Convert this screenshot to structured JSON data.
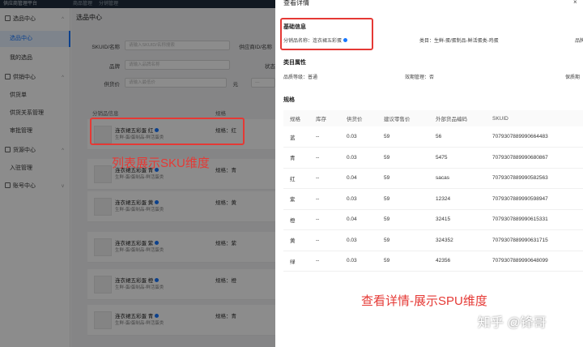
{
  "topbar": {
    "brand": "供应商管理平台",
    "tabs": [
      "商品管理",
      "分销管理"
    ]
  },
  "sidebar": {
    "groups": [
      {
        "label": "选品中心",
        "items": [
          "选品中心",
          "我的选品"
        ]
      },
      {
        "label": "供销中心",
        "items": [
          "供货单",
          "供货关系管理",
          "审批管理"
        ]
      },
      {
        "label": "货源中心",
        "items": [
          "入驻管理"
        ]
      },
      {
        "label": "账号中心",
        "items": []
      }
    ],
    "active_item": "选品中心"
  },
  "main": {
    "title": "选品中心",
    "filters": {
      "sku_label": "SKUID/名称",
      "sku_placeholder": "请输入SKUID/名称搜索",
      "supplier_label": "供应商ID/名称",
      "brand_label": "品牌",
      "brand_placeholder": "请输入品牌名称",
      "status_label": "状态",
      "price_label": "供货价",
      "price_min_placeholder": "请输入最低价",
      "price_sep": "元",
      "price_max_placeholder": "—"
    },
    "table_headers": {
      "info": "分销品信息",
      "spec": "规格",
      "action": "操作"
    },
    "rows": [
      {
        "name": "连衣裙五彩蛋 红",
        "category": "生鲜-蛋/蛋制品-鲜活蛋类",
        "spec": "规格：红"
      },
      {
        "name": "连衣裙五彩蛋 青",
        "category": "生鲜-蛋/蛋制品-鲜活蛋类",
        "spec": "规格：青"
      },
      {
        "name": "连衣裙五彩蛋 黄",
        "category": "生鲜-蛋/蛋制品-鲜活蛋类",
        "spec": "规格：黄"
      },
      {
        "name": "连衣裙五彩蛋 紫",
        "category": "生鲜-蛋/蛋制品-鲜活蛋类",
        "spec": "规格：紫"
      },
      {
        "name": "连衣裙五彩蛋 橙",
        "category": "生鲜-蛋/蛋制品-鲜活蛋类",
        "spec": "规格：橙"
      },
      {
        "name": "连衣裙五彩蛋 青",
        "category": "生鲜-蛋/蛋制品-鲜活蛋类",
        "spec": "规格：青"
      }
    ]
  },
  "drawer": {
    "title": "查看详情",
    "basic_title": "基础信息",
    "product_name": "分销品名称：连衣裙五彩蛋",
    "category": "类目：生鲜-蛋/蛋制品-鲜活蛋类-鸡蛋",
    "brand": "品牌",
    "attr_title": "类目属性",
    "quality": "品质等级：普通",
    "validity": "效期管理：否",
    "shelf": "保质期",
    "spec_title": "规格",
    "spec_headers": [
      "规格",
      "库存",
      "供货价",
      "建议零售价",
      "外部货品编码",
      "SKUID"
    ],
    "spec_rows": [
      [
        "蓝",
        "--",
        "0.03",
        "59",
        "56",
        "7079307889990664483"
      ],
      [
        "青",
        "--",
        "0.03",
        "59",
        "5475",
        "7079307889990680867"
      ],
      [
        "红",
        "--",
        "0.04",
        "59",
        "sacas",
        "7079307889990582563"
      ],
      [
        "紫",
        "--",
        "0.03",
        "59",
        "12324",
        "7079307889990598947"
      ],
      [
        "橙",
        "--",
        "0.04",
        "59",
        "32415",
        "7079307889990615331"
      ],
      [
        "黄",
        "--",
        "0.03",
        "59",
        "324352",
        "7079307889990631715"
      ],
      [
        "绿",
        "--",
        "0.03",
        "59",
        "42356",
        "7079307889990648099"
      ]
    ]
  },
  "annotations": {
    "left": "列表展示SKU维度",
    "right": "查看详情-展示SPU维度"
  },
  "watermark": "知乎 @锋哥",
  "colors": {
    "accent": "#1677ff",
    "annotation": "#e53935",
    "sidebar_active_bg": "#e6f0ff"
  }
}
